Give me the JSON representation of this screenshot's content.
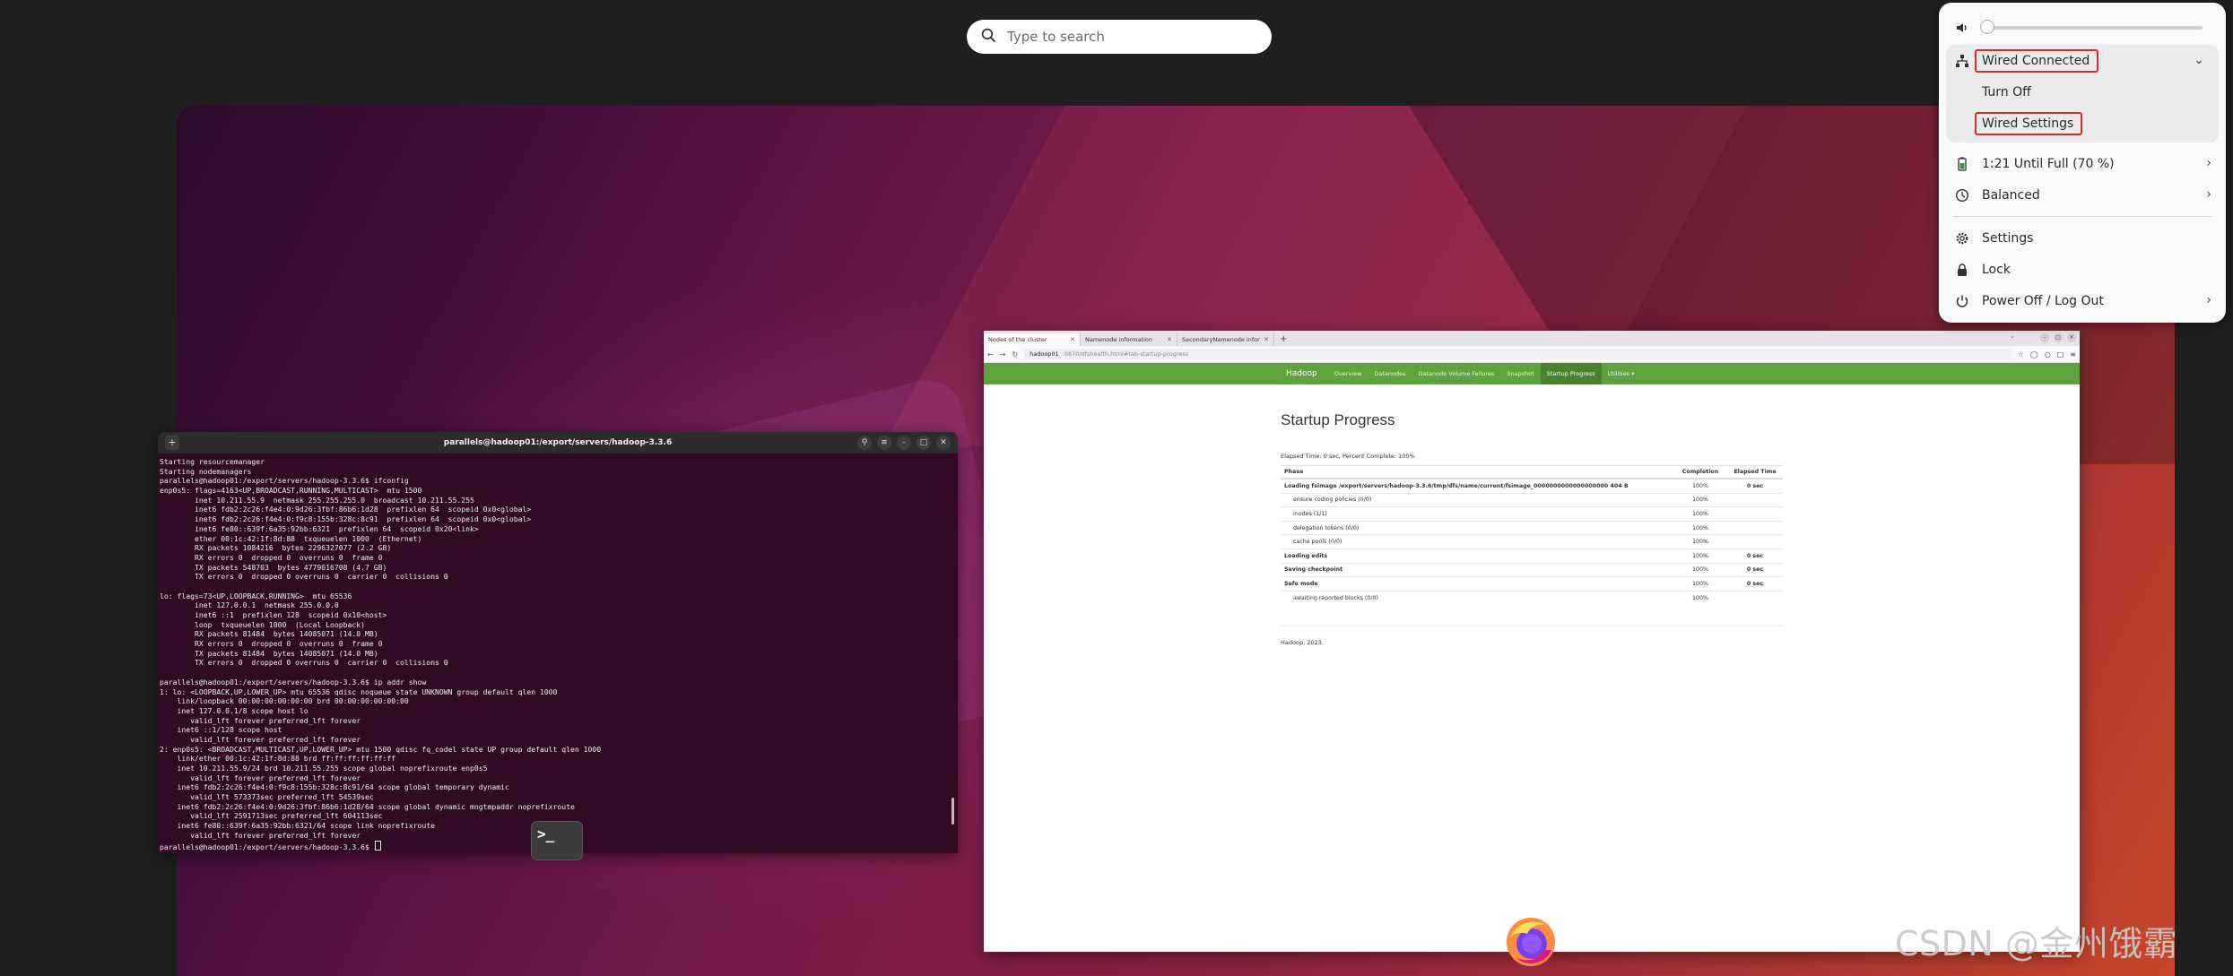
{
  "search": {
    "placeholder": "Type to search"
  },
  "terminal": {
    "title": "parallels@hadoop01:/export/servers/hadoop-3.3.6",
    "lines": [
      "Starting resourcemanager",
      "Starting nodemanagers",
      "parallels@hadoop01:/export/servers/hadoop-3.3.6$ ifconfig",
      "enp0s5: flags=4163<UP,BROADCAST,RUNNING,MULTICAST>  mtu 1500",
      "        inet 10.211.55.9  netmask 255.255.255.0  broadcast 10.211.55.255",
      "        inet6 fdb2:2c26:f4e4:0:9d26:3fbf:86b6:1d28  prefixlen 64  scopeid 0x0<global>",
      "        inet6 fdb2:2c26:f4e4:0:f9c8:155b:328c:8c91  prefixlen 64  scopeid 0x0<global>",
      "        inet6 fe80::639f:6a35:92bb:6321  prefixlen 64  scopeid 0x20<link>",
      "        ether 00:1c:42:1f:8d:88  txqueuelen 1000  (Ethernet)",
      "        RX packets 1084216  bytes 2296327077 (2.2 GB)",
      "        RX errors 0  dropped 0  overruns 0  frame 0",
      "        TX packets 548703  bytes 4779016708 (4.7 GB)",
      "        TX errors 0  dropped 0 overruns 0  carrier 0  collisions 0",
      "",
      "lo: flags=73<UP,LOOPBACK,RUNNING>  mtu 65536",
      "        inet 127.0.0.1  netmask 255.0.0.0",
      "        inet6 ::1  prefixlen 128  scopeid 0x10<host>",
      "        loop  txqueuelen 1000  (Local Loopback)",
      "        RX packets 81484  bytes 14085071 (14.0 MB)",
      "        RX errors 0  dropped 0  overruns 0  frame 0",
      "        TX packets 81484  bytes 14085071 (14.0 MB)",
      "        TX errors 0  dropped 0 overruns 0  carrier 0  collisions 0",
      "",
      "parallels@hadoop01:/export/servers/hadoop-3.3.6$ ip addr show",
      "1: lo: <LOOPBACK,UP,LOWER_UP> mtu 65536 qdisc noqueue state UNKNOWN group default qlen 1000",
      "    link/loopback 00:00:00:00:00:00 brd 00:00:00:00:00:00",
      "    inet 127.0.0.1/8 scope host lo",
      "       valid_lft forever preferred_lft forever",
      "    inet6 ::1/128 scope host",
      "       valid_lft forever preferred_lft forever",
      "2: enp0s5: <BROADCAST,MULTICAST,UP,LOWER_UP> mtu 1500 qdisc fq_codel state UP group default qlen 1000",
      "    link/ether 00:1c:42:1f:8d:88 brd ff:ff:ff:ff:ff:ff",
      "    inet 10.211.55.9/24 brd 10.211.55.255 scope global noprefixroute enp0s5",
      "       valid_lft forever preferred_lft forever",
      "    inet6 fdb2:2c26:f4e4:0:f9c8:155b:328c:8c91/64 scope global temporary dynamic",
      "       valid_lft 573373sec preferred_lft 54539sec",
      "    inet6 fdb2:2c26:f4e4:0:9d26:3fbf:86b6:1d28/64 scope global dynamic mngtmpaddr noprefixroute",
      "       valid_lft 2591713sec preferred_lft 604113sec",
      "    inet6 fe80::639f:6a35:92bb:6321/64 scope link noprefixroute",
      "       valid_lft forever preferred_lft forever",
      "parallels@hadoop01:/export/servers/hadoop-3.3.6$ "
    ]
  },
  "browser": {
    "tabs": [
      "Nodes of the cluster",
      "Namenode information",
      "SecondaryNamenode infor"
    ],
    "url_host": "hadoop01",
    "url_rest": ":9870/dfshealth.html#tab-startup-progress",
    "nav": [
      "Hadoop",
      "Overview",
      "Datanodes",
      "Datanode Volume Failures",
      "Snapshot",
      "Startup Progress",
      "Utilities ▾"
    ],
    "heading": "Startup Progress",
    "elapsed": "Elapsed Time: 0 sec, Percent Complete: 100%",
    "table": {
      "headers": [
        "Phase",
        "Completion",
        "Elapsed Time"
      ],
      "rows": [
        {
          "phase": "Loading fsimage /export/servers/hadoop-3.3.6/tmp/dfs/name/current/fsimage_0000000000000000000 404 B",
          "completion": "100%",
          "elapsed": "0 sec",
          "bold": true
        },
        {
          "phase": "ensure coding policies (0/0)",
          "completion": "100%",
          "elapsed": "",
          "bold": false
        },
        {
          "phase": "inodes (1/1)",
          "completion": "100%",
          "elapsed": "",
          "bold": false
        },
        {
          "phase": "delegation tokens (0/0)",
          "completion": "100%",
          "elapsed": "",
          "bold": false
        },
        {
          "phase": "cache pools (0/0)",
          "completion": "100%",
          "elapsed": "",
          "bold": false
        },
        {
          "phase": "Loading edits",
          "completion": "100%",
          "elapsed": "0 sec",
          "bold": true
        },
        {
          "phase": "Saving checkpoint",
          "completion": "100%",
          "elapsed": "0 sec",
          "bold": true
        },
        {
          "phase": "Safe mode",
          "completion": "100%",
          "elapsed": "0 sec",
          "bold": true
        },
        {
          "phase": "awaiting reported blocks (0/0)",
          "completion": "100%",
          "elapsed": "",
          "bold": false
        }
      ]
    },
    "footer": "Hadoop, 2023."
  },
  "quick_settings": {
    "volume_level": 0.0,
    "network": "Wired Connected",
    "turn_off": "Turn Off",
    "wired_settings": "Wired Settings",
    "battery": "1:21 Until Full (70 %)",
    "power_mode": "Balanced",
    "settings": "Settings",
    "lock": "Lock",
    "power": "Power Off / Log Out"
  },
  "watermark": "CSDN @金州饿霸",
  "colors": {
    "terminal_bg": "#300a24",
    "hadoop_green": "#5fa33e",
    "highlight_red": "#e02a2a"
  }
}
